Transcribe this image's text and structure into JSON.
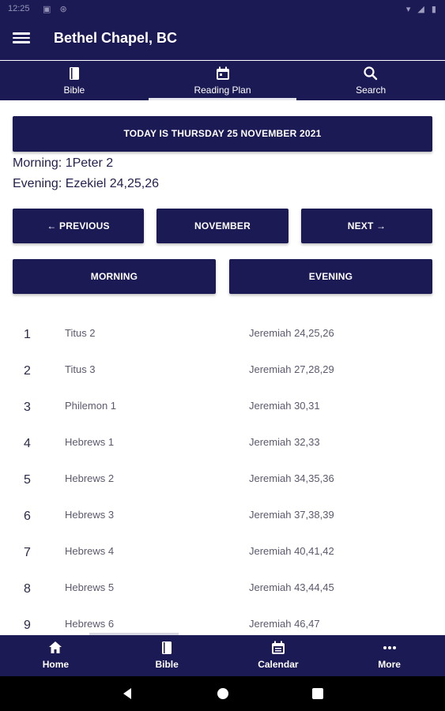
{
  "status": {
    "time": "12:25"
  },
  "app": {
    "title": "Bethel Chapel, BC"
  },
  "tabs": [
    {
      "label": "Bible",
      "icon": "book-icon"
    },
    {
      "label": "Reading Plan",
      "icon": "calendar-icon"
    },
    {
      "label": "Search",
      "icon": "search-icon"
    }
  ],
  "today": "TODAY IS THURSDAY 25 NOVEMBER 2021",
  "reading": {
    "morning": "Morning: 1Peter 2",
    "evening": "Evening: Ezekiel 24,25,26"
  },
  "nav": {
    "previous": "← PREVIOUS",
    "month": "NOVEMBER",
    "next": "NEXT →",
    "morning": "MORNING",
    "evening": "EVENING"
  },
  "plan": [
    {
      "day": "1",
      "morning": "Titus 2",
      "evening": "Jeremiah 24,25,26"
    },
    {
      "day": "2",
      "morning": "Titus 3",
      "evening": "Jeremiah 27,28,29"
    },
    {
      "day": "3",
      "morning": "Philemon 1",
      "evening": "Jeremiah 30,31"
    },
    {
      "day": "4",
      "morning": "Hebrews 1",
      "evening": "Jeremiah 32,33"
    },
    {
      "day": "5",
      "morning": "Hebrews 2",
      "evening": "Jeremiah 34,35,36"
    },
    {
      "day": "6",
      "morning": "Hebrews 3",
      "evening": "Jeremiah 37,38,39"
    },
    {
      "day": "7",
      "morning": "Hebrews 4",
      "evening": "Jeremiah 40,41,42"
    },
    {
      "day": "8",
      "morning": "Hebrews 5",
      "evening": "Jeremiah 43,44,45"
    },
    {
      "day": "9",
      "morning": "Hebrews 6",
      "evening": "Jeremiah 46,47"
    }
  ],
  "bottom_nav": [
    {
      "label": "Home",
      "icon": "home-icon"
    },
    {
      "label": "Bible",
      "icon": "book-icon"
    },
    {
      "label": "Calendar",
      "icon": "calendar-icon"
    },
    {
      "label": "More",
      "icon": "more-icon"
    }
  ],
  "colors": {
    "primary": "#1c1a55",
    "text": "#23214f",
    "muted": "#5b5a6e"
  }
}
